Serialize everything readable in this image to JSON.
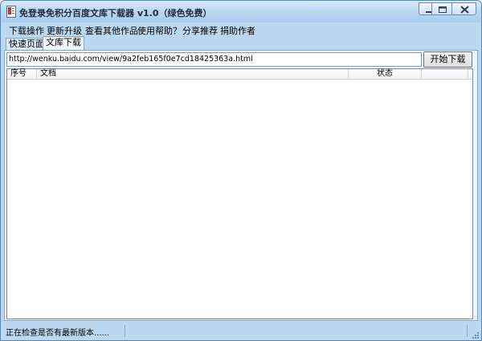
{
  "window": {
    "title": "免登录免积分百度文库下载器 v1.0（绿色免费）",
    "icon": "app-icon"
  },
  "menu": {
    "items": [
      "下载操作",
      "更新升级",
      "查看其他作品",
      "使用帮助？",
      "分享推荐",
      "捐助作者"
    ]
  },
  "tabs": [
    {
      "label": "快速页面",
      "active": false
    },
    {
      "label": "文库下载",
      "active": true
    }
  ],
  "download": {
    "url_value": "http://wenku.baidu.com/view/9a2feb165f0e7cd18425363a.html",
    "start_label": "开始下载"
  },
  "table": {
    "columns": [
      "序号",
      "文档",
      "状态",
      ""
    ],
    "rows": []
  },
  "status": {
    "message": "正在检查是否有最新版本......"
  },
  "colors": {
    "frame": "#bcd8f1",
    "panel": "#eef4fb",
    "border": "#8aa7c6"
  }
}
